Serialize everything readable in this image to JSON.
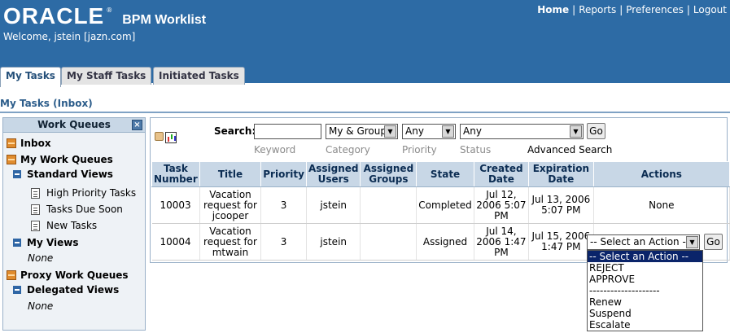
{
  "header": {
    "brand": "ORACLE",
    "trademark": "®",
    "app_title": "BPM Worklist",
    "welcome": "Welcome, jstein [jazn.com]",
    "nav": [
      "Home",
      "Reports",
      "Preferences",
      "Logout"
    ],
    "nav_separator": "|"
  },
  "tabs": [
    "My Tasks",
    "My Staff Tasks",
    "Initiated Tasks"
  ],
  "page_heading": "My Tasks (Inbox)",
  "sidebar": {
    "title": "Work Queues",
    "close": "×",
    "inbox": "Inbox",
    "my_work_queues": "My Work Queues",
    "standard_views": "Standard Views",
    "views": [
      "High Priority Tasks",
      "Tasks Due Soon",
      "New Tasks"
    ],
    "my_views": "My Views",
    "my_views_none": "None",
    "proxy_work_queues": "Proxy Work Queues",
    "delegated_views": "Delegated Views",
    "delegated_none": "None"
  },
  "search": {
    "label": "Search:",
    "keyword_value": "",
    "category_value": "My & Group",
    "priority_value": "Any",
    "status_value": "Any",
    "go": "Go",
    "hints": [
      "Keyword",
      "Category",
      "Priority",
      "Status"
    ],
    "advanced": "Advanced Search"
  },
  "table": {
    "headers": [
      "Task Number",
      "Title",
      "Priority",
      "Assigned Users",
      "Assigned Groups",
      "State",
      "Created Date",
      "Expiration Date",
      "Actions"
    ],
    "rows": [
      [
        "10003",
        "Vacation request for jcooper",
        "3",
        "jstein",
        "",
        "Completed",
        "Jul 12, 2006 5:07 PM",
        "Jul 13, 2006 5:07 PM",
        "None"
      ],
      [
        "10004",
        "Vacation request for mtwain",
        "3",
        "jstein",
        "",
        "Assigned",
        "Jul 14, 2006 1:47 PM",
        "Jul 15, 2006 1:47 PM",
        ""
      ]
    ]
  },
  "row_action": {
    "selected": "-- Select an Action --",
    "go": "Go",
    "options": [
      "-- Select an Action --",
      "REJECT",
      "APPROVE",
      "--------------------",
      "Renew",
      "Suspend",
      "Escalate"
    ]
  },
  "colors": {
    "header_bg": "#2d6ba5",
    "table_header_bg": "#c8d7e6",
    "selected_option_bg": "#0a246a"
  }
}
